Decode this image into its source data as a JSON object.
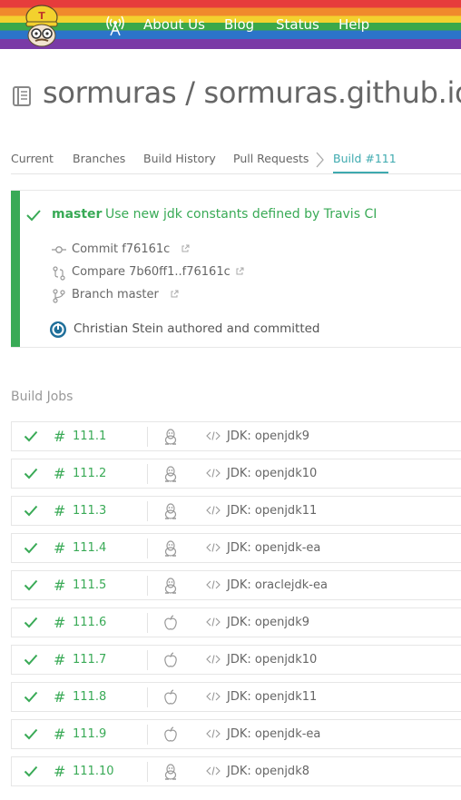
{
  "header": {
    "nav": [
      "About Us",
      "Blog",
      "Status",
      "Help"
    ]
  },
  "repo": {
    "title": "sormuras / sormuras.github.io"
  },
  "tabs": {
    "items": [
      "Current",
      "Branches",
      "Build History",
      "Pull Requests"
    ],
    "active": "Build #111"
  },
  "build": {
    "branch": "master",
    "message": "Use new jdk constants defined by Travis CI",
    "commit": "Commit f76161c",
    "compare": "Compare 7b60ff1..f76161c",
    "branch_link": "Branch master",
    "author": "Christian Stein authored and committed"
  },
  "jobs_heading": "Build Jobs",
  "jobs": [
    {
      "number": "111.1",
      "os": "linux-icon",
      "env": "JDK: openjdk9"
    },
    {
      "number": "111.2",
      "os": "linux-icon",
      "env": "JDK: openjdk10"
    },
    {
      "number": "111.3",
      "os": "linux-icon",
      "env": "JDK: openjdk11"
    },
    {
      "number": "111.4",
      "os": "linux-icon",
      "env": "JDK: openjdk-ea"
    },
    {
      "number": "111.5",
      "os": "linux-icon",
      "env": "JDK: oraclejdk-ea"
    },
    {
      "number": "111.6",
      "os": "apple-icon",
      "env": "JDK: openjdk9"
    },
    {
      "number": "111.7",
      "os": "apple-icon",
      "env": "JDK: openjdk10"
    },
    {
      "number": "111.8",
      "os": "apple-icon",
      "env": "JDK: openjdk11"
    },
    {
      "number": "111.9",
      "os": "apple-icon",
      "env": "JDK: openjdk-ea"
    },
    {
      "number": "111.10",
      "os": "linux-icon",
      "env": "JDK: openjdk8"
    }
  ],
  "colors": {
    "success": "#39aa56",
    "accent": "#3eaaaf",
    "text": "#666666"
  }
}
